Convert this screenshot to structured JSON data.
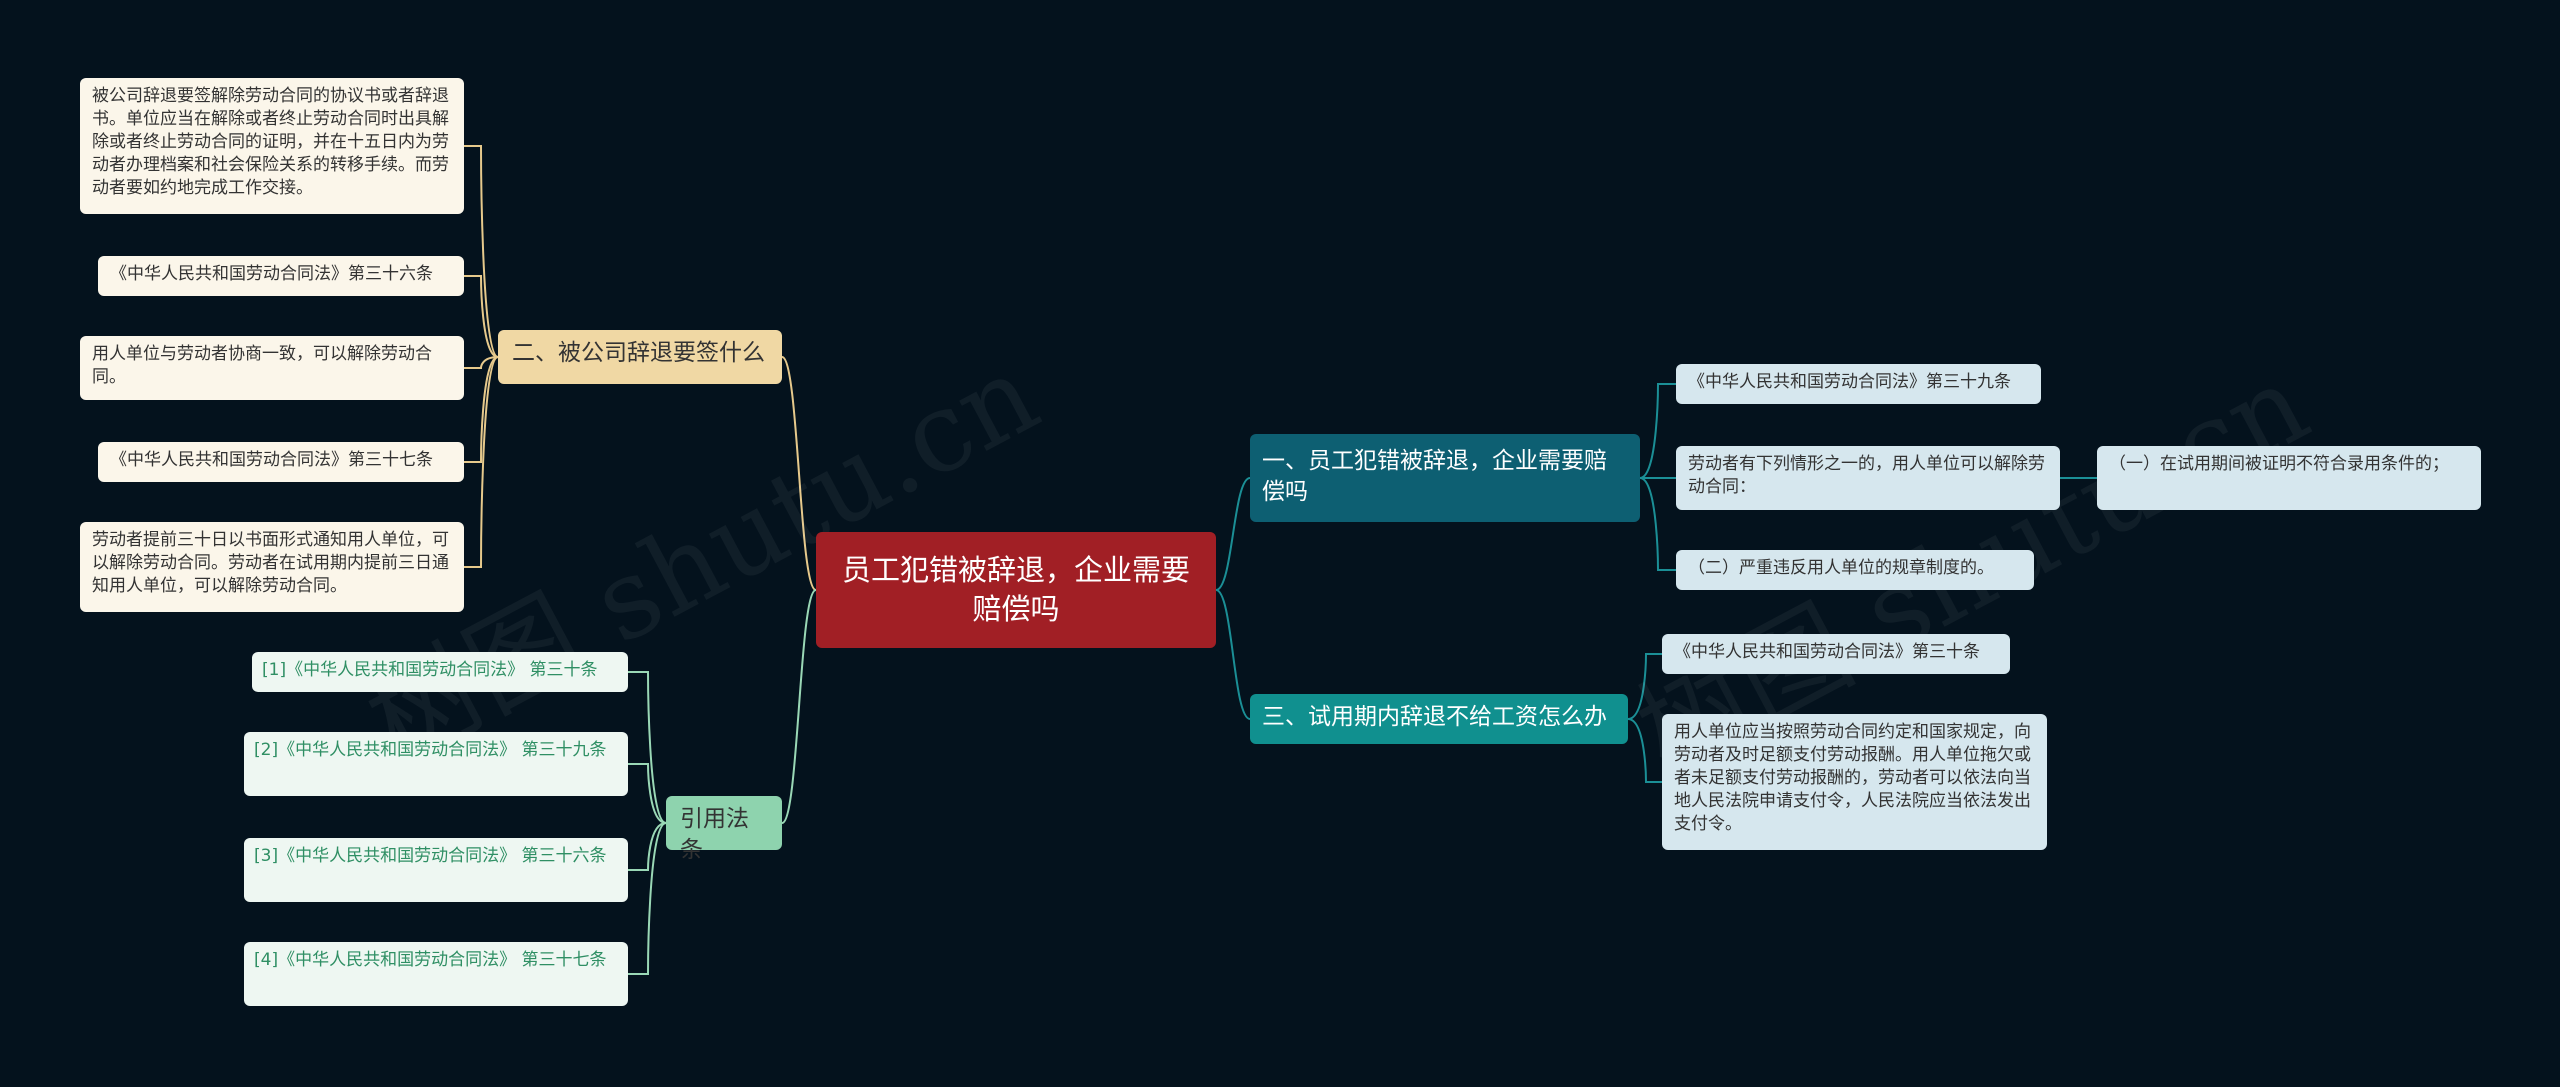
{
  "root": {
    "label": "员工犯错被辞退，企业需要赔偿吗"
  },
  "branch1": {
    "label": "一、员工犯错被辞退，企业需要赔偿吗",
    "items": [
      "《中华人民共和国劳动合同法》第三十九条",
      "劳动者有下列情形之一的，用人单位可以解除劳动合同：",
      "（二）严重违反用人单位的规章制度的。"
    ],
    "sub_item": "（一）在试用期间被证明不符合录用条件的；"
  },
  "branch3": {
    "label": "三、试用期内辞退不给工资怎么办",
    "items": [
      "《中华人民共和国劳动合同法》第三十条",
      "用人单位应当按照劳动合同约定和国家规定，向劳动者及时足额支付劳动报酬。用人单位拖欠或者未足额支付劳动报酬的，劳动者可以依法向当地人民法院申请支付令，人民法院应当依法发出支付令。"
    ]
  },
  "branch2": {
    "label": "二、被公司辞退要签什么",
    "items": [
      "被公司辞退要签解除劳动合同的协议书或者辞退书。单位应当在解除或者终止劳动合同时出具解除或者终止劳动合同的证明，并在十五日内为劳动者办理档案和社会保险关系的转移手续。而劳动者要如约地完成工作交接。",
      "《中华人民共和国劳动合同法》第三十六条",
      "用人单位与劳动者协商一致，可以解除劳动合同。",
      "《中华人民共和国劳动合同法》第三十七条",
      "劳动者提前三十日以书面形式通知用人单位，可以解除劳动合同。劳动者在试用期内提前三日通知用人单位，可以解除劳动合同。"
    ]
  },
  "citations": {
    "label": "引用法条",
    "items": [
      "[1]《中华人民共和国劳动合同法》 第三十条",
      "[2]《中华人民共和国劳动合同法》 第三十九条",
      "[3]《中华人民共和国劳动合同法》 第三十六条",
      "[4]《中华人民共和国劳动合同法》 第三十七条"
    ]
  },
  "watermark": "树图 shutu.cn",
  "colors": {
    "background": "#04121d",
    "root": "#a11f25",
    "branch1": "#0d5f72",
    "branch3": "#10908f",
    "branch2": "#f0d8a4",
    "citations": "#8ed3ae",
    "link_teal": "#1b8f96",
    "link_sand": "#e6c98c",
    "link_mint": "#9ad8b6"
  }
}
